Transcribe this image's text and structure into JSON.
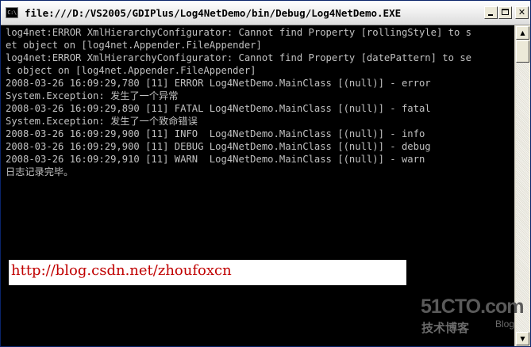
{
  "window": {
    "title": "file:///D:/VS2005/GDIPlus/Log4NetDemo/bin/Debug/Log4NetDemo.EXE",
    "app_icon": "console-app-icon",
    "app_icon_text": "C:\\",
    "buttons": {
      "minimize_icon": "minimize-icon",
      "maximize_icon": "maximize-icon",
      "close_icon": "close-icon",
      "close_label": "✕"
    }
  },
  "console": {
    "lines": [
      "log4net:ERROR XmlHierarchyConfigurator: Cannot find Property [rollingStyle] to s",
      "et object on [log4net.Appender.FileAppender]",
      "log4net:ERROR XmlHierarchyConfigurator: Cannot find Property [datePattern] to se",
      "t object on [log4net.Appender.FileAppender]",
      "2008-03-26 16:09:29,780 [11] ERROR Log4NetDemo.MainClass [(null)] - error",
      "System.Exception: 发生了一个异常",
      "2008-03-26 16:09:29,890 [11] FATAL Log4NetDemo.MainClass [(null)] - fatal",
      "System.Exception: 发生了一个致命错误",
      "2008-03-26 16:09:29,900 [11] INFO  Log4NetDemo.MainClass [(null)] - info",
      "2008-03-26 16:09:29,900 [11] DEBUG Log4NetDemo.MainClass [(null)] - debug",
      "2008-03-26 16:09:29,910 [11] WARN  Log4NetDemo.MainClass [(null)] - warn",
      "日志记录完毕。"
    ],
    "text_color": "#c0c0c0",
    "background": "#000000"
  },
  "overlay": {
    "url": "http://blog.csdn.net/zhoufoxcn",
    "url_color": "#c00000"
  },
  "watermark": {
    "main": "51CTO.com",
    "sub": "技术博客",
    "blog": "Blog"
  },
  "scrollbar": {
    "up_icon": "scroll-up-arrow-icon",
    "up_glyph": "▲",
    "down_icon": "scroll-down-arrow-icon",
    "down_glyph": "▼"
  }
}
